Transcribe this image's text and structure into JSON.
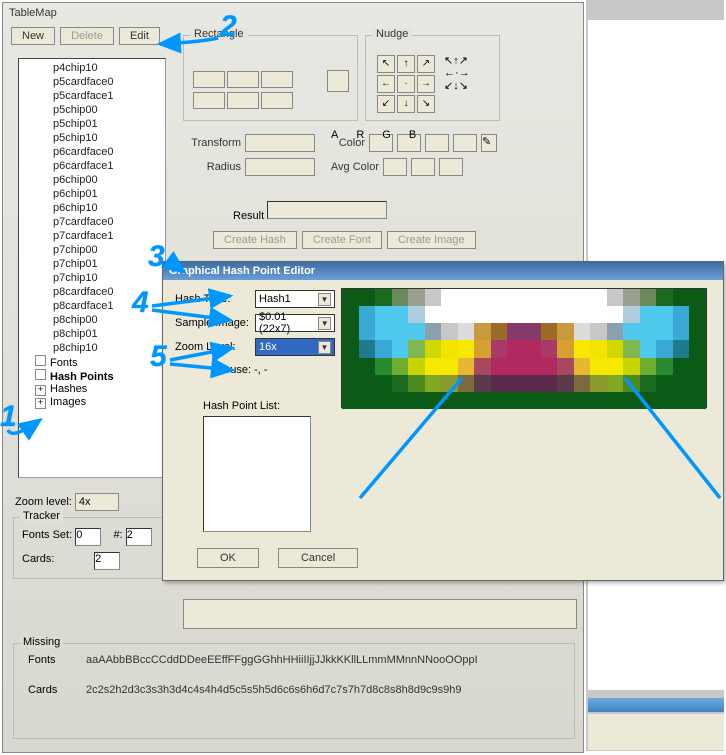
{
  "window": {
    "title": "TableMap"
  },
  "toolbar": {
    "new": "New",
    "delete": "Delete",
    "edit": "Edit"
  },
  "tree": {
    "items": [
      "p4chip10",
      "p5cardface0",
      "p5cardface1",
      "p5chip00",
      "p5chip01",
      "p5chip10",
      "p6cardface0",
      "p6cardface1",
      "p6chip00",
      "p6chip01",
      "p6chip10",
      "p7cardface0",
      "p7cardface1",
      "p7chip00",
      "p7chip01",
      "p7chip10",
      "p8cardface0",
      "p8cardface1",
      "p8chip00",
      "p8chip01",
      "p8chip10"
    ],
    "roots": [
      "Fonts",
      "Hash Points",
      "Hashes",
      "Images"
    ]
  },
  "rectangle": {
    "legend": "Rectangle"
  },
  "nudge": {
    "legend": "Nudge"
  },
  "mid": {
    "transform": "Transform",
    "radius": "Radius",
    "color": "Color",
    "avgcolor": "Avg Color",
    "a": "A",
    "r": "R",
    "g": "G",
    "b": "B",
    "result": "Result"
  },
  "create": {
    "hash": "Create Hash",
    "font": "Create Font",
    "image": "Create Image"
  },
  "zoom": {
    "label": "Zoom level:",
    "value": "4x"
  },
  "tracker": {
    "legend": "Tracker",
    "fontsset": "Fonts Set:",
    "fontsval": "0",
    "hash": "#:",
    "hashval": "2",
    "cards": "Cards:",
    "cardsval": "2"
  },
  "missing": {
    "legend": "Missing",
    "fonts_label": "Fonts",
    "fonts_val": "aaAAbbBBccCCddDDeeEEffFFggGGhhHHiiIIjjJJkkKKllLLmmMMnnNNooOOppI",
    "cards_label": "Cards",
    "cards_val": "2c2s2h2d3c3s3h3d4c4s4h4d5c5s5h5d6c6s6h6d7c7s7h7d8c8s8h8d9c9s9h9"
  },
  "dialog": {
    "title": "Graphical Hash Point Editor",
    "hash_type_label": "Hash Type:",
    "hash_type_value": "Hash1",
    "sample_image_label": "Sample Image:",
    "sample_image_value": "$0.01 (22x7)",
    "zoom_label": "Zoom Level:",
    "zoom_value": "16x",
    "mouse": "Mouse: -, -",
    "hplist": "Hash Point List:",
    "ok": "OK",
    "cancel": "Cancel"
  },
  "pixel_grid": {
    "width": 22,
    "height": 7,
    "rows": [
      [
        "#0b5a16",
        "#0b5a16",
        "#1a6b20",
        "#6a8a5c",
        "#9aa090",
        "#c8c8c8",
        "#ffffff",
        "#ffffff",
        "#ffffff",
        "#ffffff",
        "#ffffff",
        "#ffffff",
        "#ffffff",
        "#ffffff",
        "#ffffff",
        "#ffffff",
        "#c8c8c8",
        "#9aa090",
        "#6a8a5c",
        "#1a6b20",
        "#0b5a16",
        "#0b5a16"
      ],
      [
        "#0b5a16",
        "#3aa8d4",
        "#4fc9ed",
        "#4fc9ed",
        "#b0cde0",
        "#ffffff",
        "#ffffff",
        "#ffffff",
        "#ffffff",
        "#ffffff",
        "#ffffff",
        "#ffffff",
        "#ffffff",
        "#ffffff",
        "#ffffff",
        "#ffffff",
        "#ffffff",
        "#b0cde0",
        "#4fc9ed",
        "#4fc9ed",
        "#3aa8d4",
        "#0b5a16"
      ],
      [
        "#0b5a16",
        "#3aa8d4",
        "#4fc9ed",
        "#4fc9ed",
        "#4fc9ed",
        "#8aa0b0",
        "#c8c8c8",
        "#dcdcdc",
        "#c89a3c",
        "#9c6b28",
        "#863a6a",
        "#863a6a",
        "#9c6b28",
        "#c89a3c",
        "#dcdcdc",
        "#c8c8c8",
        "#8aa0b0",
        "#4fc9ed",
        "#4fc9ed",
        "#4fc9ed",
        "#3aa8d4",
        "#0b5a16"
      ],
      [
        "#0b5a16",
        "#1e7a8c",
        "#3aa8d4",
        "#4fc9ed",
        "#7fb850",
        "#cfd800",
        "#f2e400",
        "#f6e800",
        "#d8a030",
        "#a83a6a",
        "#b02a60",
        "#b02a60",
        "#a83a6a",
        "#d8a030",
        "#f6e800",
        "#f2e400",
        "#cfd800",
        "#7fb850",
        "#4fc9ed",
        "#3aa8d4",
        "#1e7a8c",
        "#0b5a16"
      ],
      [
        "#0b5a16",
        "#0b5a16",
        "#2a8a30",
        "#6fae30",
        "#c8d400",
        "#f6e800",
        "#f6e800",
        "#e6b830",
        "#a84860",
        "#b02a60",
        "#b02a60",
        "#b02a60",
        "#b02a60",
        "#a84860",
        "#e6b830",
        "#f6e800",
        "#f6e800",
        "#c8d400",
        "#6fae30",
        "#2a8a30",
        "#0b5a16",
        "#0b5a16"
      ],
      [
        "#0b5a16",
        "#0b5a16",
        "#0b5a16",
        "#1a6b20",
        "#4a8a20",
        "#7fa820",
        "#8a9a2c",
        "#7a6a3c",
        "#5a3a4a",
        "#5a2a4a",
        "#5a2a4a",
        "#5a2a4a",
        "#5a2a4a",
        "#5a3a4a",
        "#7a6a3c",
        "#8a9a2c",
        "#7fa820",
        "#4a8a20",
        "#1a6b20",
        "#0b5a16",
        "#0b5a16",
        "#0b5a16"
      ],
      [
        "#0b5a16",
        "#0b5a16",
        "#0b5a16",
        "#0b5a16",
        "#0b5a16",
        "#0b5a16",
        "#0b5a16",
        "#0b5a16",
        "#0b5a16",
        "#0b5a16",
        "#0b5a16",
        "#0b5a16",
        "#0b5a16",
        "#0b5a16",
        "#0b5a16",
        "#0b5a16",
        "#0b5a16",
        "#0b5a16",
        "#0b5a16",
        "#0b5a16",
        "#0b5a16",
        "#0b5a16"
      ]
    ]
  },
  "annotations": [
    "1",
    "2",
    "3",
    "4",
    "5"
  ]
}
